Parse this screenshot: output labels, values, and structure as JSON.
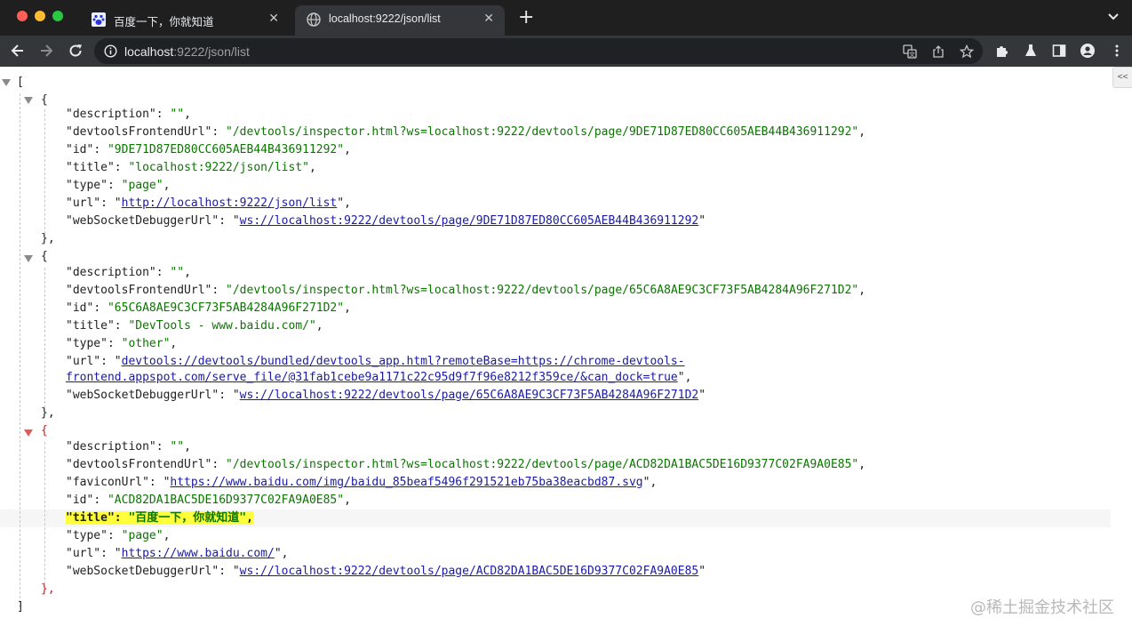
{
  "tabs": [
    {
      "title": "百度一下，你就知道",
      "favicon": "baidu-paw-icon",
      "active": false
    },
    {
      "title": "localhost:9222/json/list",
      "favicon": "globe-icon",
      "active": true
    }
  ],
  "address": {
    "host": "localhost",
    "rest": ":9222/json/list"
  },
  "icons": {
    "back": "arrow-left-icon",
    "forward": "arrow-right-icon",
    "reload": "reload-icon",
    "info": "info-icon",
    "translate": "translate-icon",
    "share": "share-icon",
    "bookmark": "star-icon",
    "extensions": "puzzle-icon",
    "labs": "flask-icon",
    "sidepanel": "side-panel-icon",
    "profile": "profile-icon",
    "menu": "kebab-menu-icon"
  },
  "json": {
    "open_bracket": "[",
    "close_bracket": "]",
    "entries": [
      {
        "open": "{",
        "close": "},",
        "fields": [
          {
            "k": "\"description\"",
            "v": "\"\"",
            "trail": ","
          },
          {
            "k": "\"devtoolsFrontendUrl\"",
            "v": "\"/devtools/inspector.html?ws=localhost:9222/devtools/page/9DE71D87ED80CC605AEB44B436911292\"",
            "trail": ","
          },
          {
            "k": "\"id\"",
            "v": "\"9DE71D87ED80CC605AEB44B436911292\"",
            "trail": ","
          },
          {
            "k": "\"title\"",
            "v": "\"localhost:9222/json/list\"",
            "trail": ","
          },
          {
            "k": "\"type\"",
            "v": "\"page\"",
            "trail": ","
          },
          {
            "k": "\"url\"",
            "v": "http://localhost:9222/json/list",
            "trail": ","
          },
          {
            "k": "\"webSocketDebuggerUrl\"",
            "v": "ws://localhost:9222/devtools/page/9DE71D87ED80CC605AEB44B436911292",
            "trail": ""
          }
        ]
      },
      {
        "open": "{",
        "close": "},",
        "fields": [
          {
            "k": "\"description\"",
            "v": "\"\"",
            "trail": ","
          },
          {
            "k": "\"devtoolsFrontendUrl\"",
            "v": "\"/devtools/inspector.html?ws=localhost:9222/devtools/page/65C6A8AE9C3CF73F5AB4284A96F271D2\"",
            "trail": ","
          },
          {
            "k": "\"id\"",
            "v": "\"65C6A8AE9C3CF73F5AB4284A96F271D2\"",
            "trail": ","
          },
          {
            "k": "\"title\"",
            "v": "\"DevTools - www.baidu.com/\"",
            "trail": ","
          },
          {
            "k": "\"type\"",
            "v": "\"other\"",
            "trail": ","
          },
          {
            "k": "\"url\"",
            "v": "devtools://devtools/bundled/devtools_app.html?remoteBase=https://chrome-devtools-",
            "v2": "frontend.appspot.com/serve_file/@31fab1cebe9a1171c22c95d9f7f96e8212f359ce/&can_dock=true",
            "trail": ","
          },
          {
            "k": "\"webSocketDebuggerUrl\"",
            "v": "ws://localhost:9222/devtools/page/65C6A8AE9C3CF73F5AB4284A96F271D2",
            "trail": ""
          }
        ]
      },
      {
        "open": "{",
        "close": "},",
        "fields": [
          {
            "k": "\"description\"",
            "v": "\"\"",
            "trail": ","
          },
          {
            "k": "\"devtoolsFrontendUrl\"",
            "v": "\"/devtools/inspector.html?ws=localhost:9222/devtools/page/ACD82DA1BAC5DE16D9377C02FA9A0E85\"",
            "trail": ","
          },
          {
            "k": "\"faviconUrl\"",
            "v": "https://www.baidu.com/img/baidu_85beaf5496f291521eb75ba38eacbd87.svg",
            "trail": ","
          },
          {
            "k": "\"id\"",
            "v": "\"ACD82DA1BAC5DE16D9377C02FA9A0E85\"",
            "trail": ","
          },
          {
            "k": "\"title\"",
            "v": "\"百度一下，你就知道\"",
            "trail": ","
          },
          {
            "k": "\"type\"",
            "v": "\"page\"",
            "trail": ","
          },
          {
            "k": "\"url\"",
            "v": "https://www.baidu.com/",
            "trail": ","
          },
          {
            "k": "\"webSocketDebuggerUrl\"",
            "v": "ws://localhost:9222/devtools/page/ACD82DA1BAC5DE16D9377C02FA9A0E85",
            "trail": ""
          }
        ]
      }
    ]
  },
  "sidebar_toggle": "<<",
  "watermark": "@稀土掘金技术社区",
  "colors": {
    "string": "#0b7500",
    "link": "#1a1aa6",
    "highlight": "#ffff3c",
    "selected_brace": "#cc1b1b"
  }
}
